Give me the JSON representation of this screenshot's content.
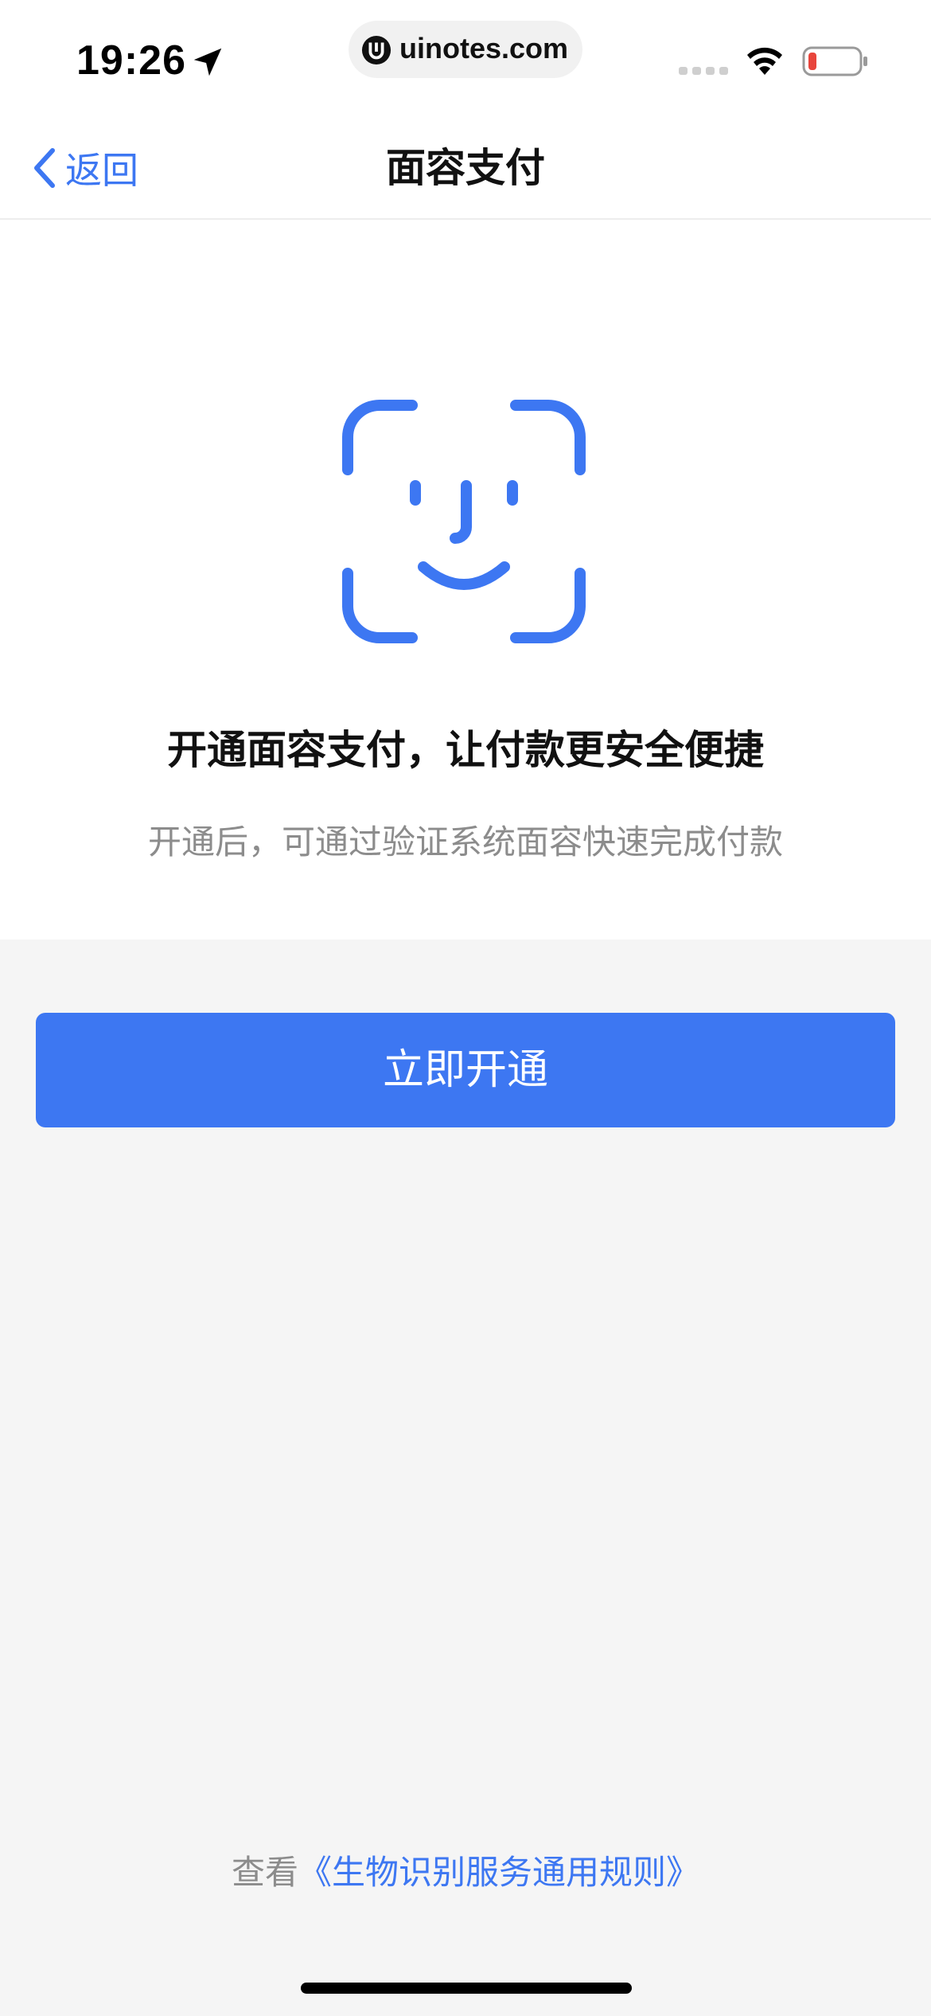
{
  "status_bar": {
    "time": "19:26",
    "url": "uinotes.com",
    "icons": [
      "location-arrow-icon",
      "uinotes-logo-icon",
      "cellular-signal-icon",
      "wifi-icon",
      "battery-low-icon"
    ],
    "battery_color": "#e8453c"
  },
  "nav": {
    "back_label": "返回",
    "title": "面容支付"
  },
  "content": {
    "icon": "face-id-icon",
    "headline": "开通面容支付，让付款更安全便捷",
    "subline": "开通后，可通过验证系统面容快速完成付款"
  },
  "primary_button": {
    "label": "立即开通"
  },
  "footer": {
    "prefix": "查看",
    "link": "《生物识别服务通用规则》"
  },
  "colors": {
    "accent": "#3d77f2",
    "page_background": "#f5f5f5",
    "card_background": "#ffffff",
    "secondary_text": "#8c8c8c"
  }
}
